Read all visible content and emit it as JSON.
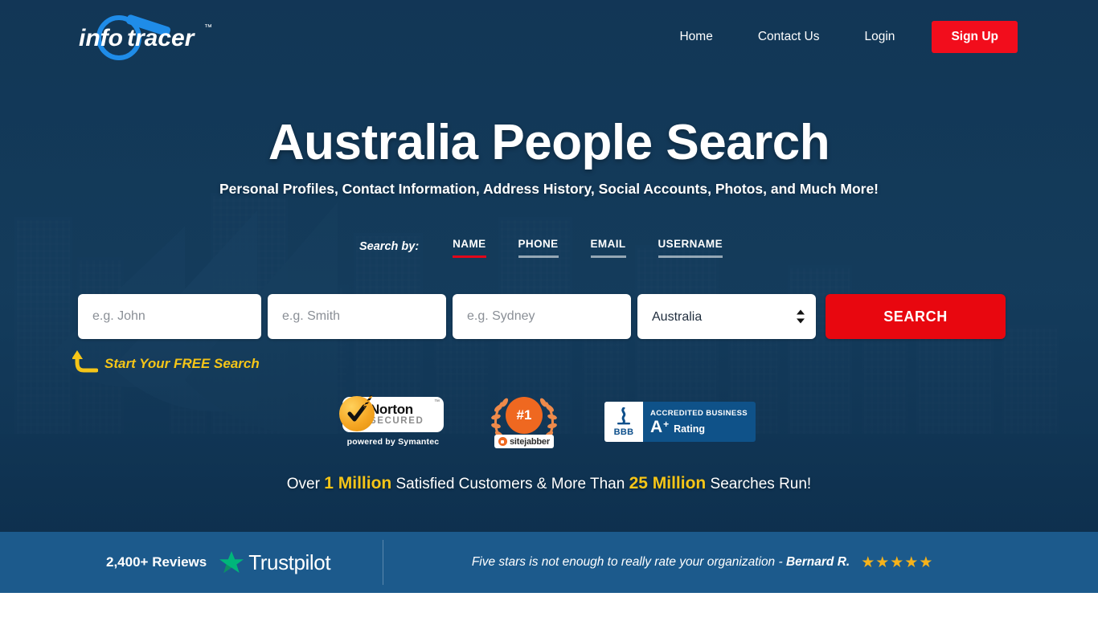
{
  "brand": {
    "name": "infotracer",
    "logo_text_1": "info",
    "logo_text_2": "tracer",
    "trademark": "™",
    "accent_red": "#f20d1c",
    "accent_yellow": "#f5c518",
    "hero_bg": "#143a5c",
    "trustpilot_bar_bg": "#1c5a8c"
  },
  "header": {
    "nav": [
      {
        "label": "Home",
        "name": "nav-home"
      },
      {
        "label": "Contact Us",
        "name": "nav-contact-us"
      },
      {
        "label": "Login",
        "name": "nav-login"
      }
    ],
    "signup_label": "Sign Up"
  },
  "hero": {
    "title": "Australia People Search",
    "subtitle": "Personal Profiles, Contact Information, Address History, Social Accounts, Photos, and Much More!",
    "background_image": "sydney-opera-house-skyline"
  },
  "search": {
    "search_by_label": "Search by:",
    "tabs": [
      {
        "label": "NAME",
        "active": true
      },
      {
        "label": "PHONE",
        "active": false
      },
      {
        "label": "EMAIL",
        "active": false
      },
      {
        "label": "USERNAME",
        "active": false
      }
    ],
    "fields": {
      "first_name": {
        "placeholder": "e.g. John",
        "value": ""
      },
      "last_name": {
        "placeholder": "e.g. Smith",
        "value": ""
      },
      "city": {
        "placeholder": "e.g. Sydney",
        "value": ""
      }
    },
    "country_select": {
      "selected": "Australia",
      "options": [
        "Australia"
      ]
    },
    "submit_label": "SEARCH",
    "free_callout": "Start Your FREE Search"
  },
  "badges": {
    "norton": {
      "title": "Norton",
      "subtitle": "SECURED",
      "trademark": "™",
      "footer": "powered by Symantec"
    },
    "sitejabber": {
      "rank": "#1",
      "name": "sitejabber"
    },
    "bbb": {
      "acronym": "BBB",
      "accredited": "ACCREDITED BUSINESS",
      "grade": "A",
      "grade_plus": "+",
      "rating_label": "Rating"
    }
  },
  "stats": {
    "prefix": "Over ",
    "customers_count": "1 Million",
    "middle": " Satisfied Customers & More Than ",
    "searches_count": "25 Million",
    "suffix": " Searches Run!"
  },
  "trustpilot": {
    "reviews_count": "2,400+ Reviews",
    "logo_word": "Trustpilot",
    "quote": "Five stars is not enough to really rate your organization - ",
    "author": "Bernard R.",
    "stars": "★★★★★",
    "star_count": 5,
    "star_color": "#f5b21b"
  }
}
